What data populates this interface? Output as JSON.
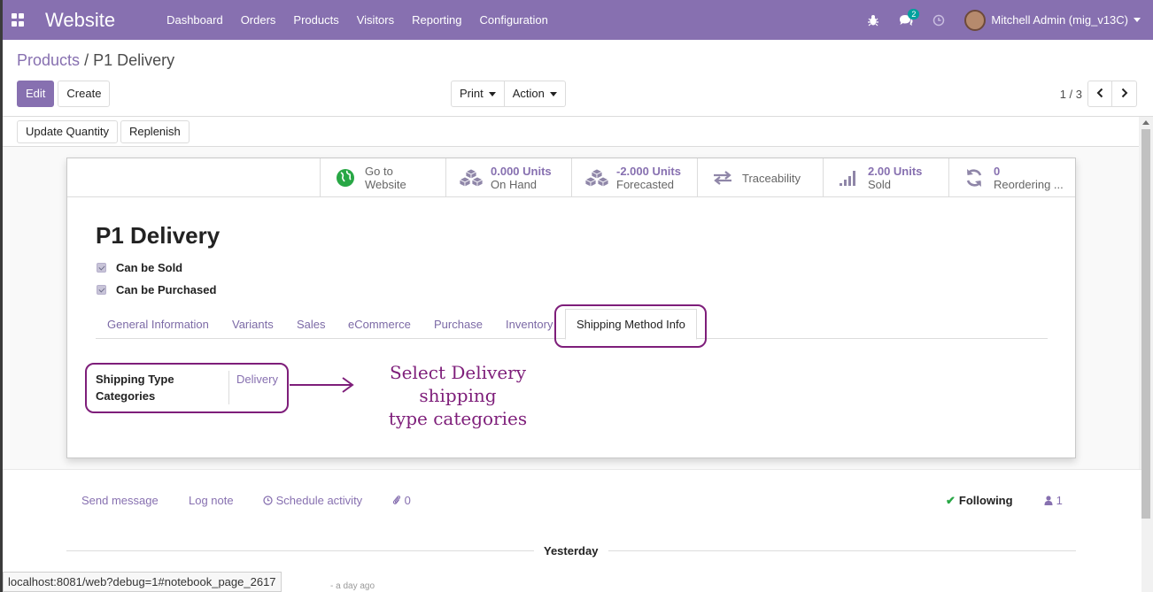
{
  "topbar": {
    "app_name": "Website",
    "menu": [
      "Dashboard",
      "Orders",
      "Products",
      "Visitors",
      "Reporting",
      "Configuration"
    ],
    "messages_badge": "2",
    "user": "Mitchell Admin (mig_v13C)",
    "color": "#8770b0"
  },
  "breadcrumb": {
    "parent": "Products",
    "separator": "/",
    "current": "P1 Delivery"
  },
  "control": {
    "edit_label": "Edit",
    "create_label": "Create",
    "print_label": "Print",
    "action_label": "Action",
    "pager_value": "1 / 3",
    "prev_icon": "chevron-left-icon",
    "next_icon": "chevron-right-icon"
  },
  "status_buttons": {
    "update_quantity": "Update Quantity",
    "replenish": "Replenish"
  },
  "smart_buttons": [
    {
      "icon": "globe-icon",
      "value": "Go to",
      "label": "Website"
    },
    {
      "icon": "cubes-icon",
      "value": "0.000 Units",
      "label": "On Hand"
    },
    {
      "icon": "cubes-icon",
      "value": "-2.000 Units",
      "label": "Forecasted"
    },
    {
      "icon": "exchange-icon",
      "label": "Traceability"
    },
    {
      "icon": "signal-icon",
      "value": "2.00 Units",
      "label": "Sold"
    },
    {
      "icon": "refresh-icon",
      "value": "0",
      "label": "Reordering ..."
    }
  ],
  "product": {
    "name": "P1 Delivery",
    "can_be_sold": "Can be Sold",
    "can_be_purchased": "Can be Purchased"
  },
  "tabs": [
    "General Information",
    "Variants",
    "Sales",
    "eCommerce",
    "Purchase",
    "Inventory",
    "Shipping Method Info"
  ],
  "active_tab": "Shipping Method Info",
  "shipping": {
    "label_line1": "Shipping Type",
    "label_line2": "Categories",
    "value": "Delivery"
  },
  "annotation": {
    "line1": "Select  Delivery  shipping",
    "line2": "type  categories",
    "color": "#7e1e7a"
  },
  "chatter": {
    "send_message": "Send message",
    "log_note": "Log note",
    "schedule_activity": "Schedule activity",
    "attachments": "0",
    "following": "Following",
    "followers": "1",
    "separator": "Yesterday",
    "peek": "- a day ago"
  },
  "status_url": "localhost:8081/web?debug=1#notebook_page_2617"
}
